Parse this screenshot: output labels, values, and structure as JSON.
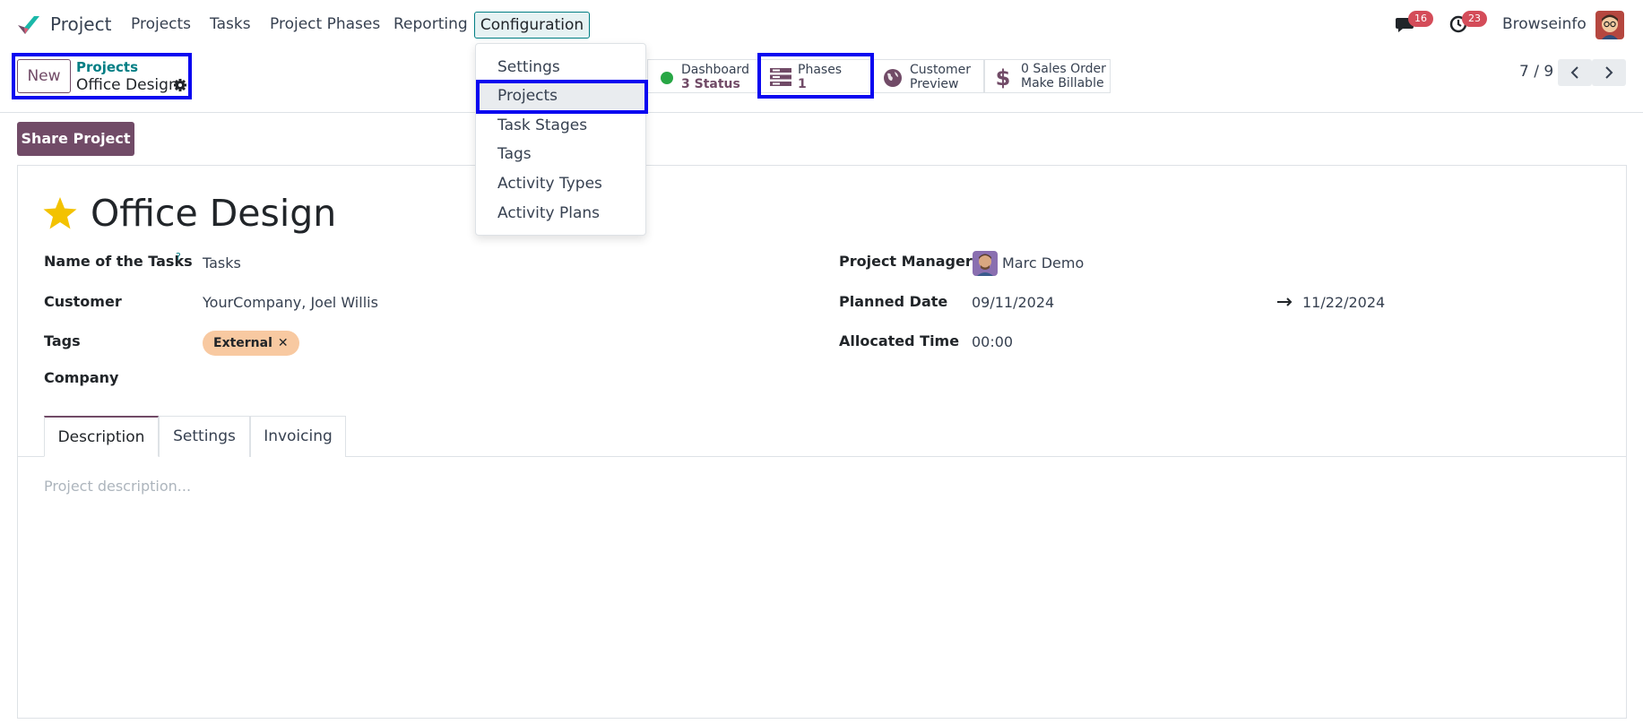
{
  "app": {
    "name": "Project"
  },
  "navbar": {
    "menus": [
      "Projects",
      "Tasks",
      "Project Phases",
      "Reporting",
      "Configuration"
    ],
    "messages_badge": "16",
    "activities_badge": "23",
    "company": "Browseinfo"
  },
  "control_panel": {
    "new_label": "New",
    "breadcrumb_parent": "Projects",
    "breadcrumb_current": "Office Design",
    "smart_buttons": {
      "dashboard": {
        "label": "Dashboard",
        "value": "3 Status"
      },
      "phases": {
        "label": "Phases",
        "value": "1"
      },
      "customer_preview": {
        "line1": "Customer",
        "line2": "Preview"
      },
      "sales_order": {
        "line1": "0 Sales Order",
        "line2": "Make Billable"
      }
    },
    "pager": "7 / 9"
  },
  "configuration_menu": {
    "items": [
      "Settings",
      "Projects",
      "Task Stages",
      "Tags",
      "Activity Types",
      "Activity Plans"
    ],
    "active": "Projects"
  },
  "share_label": "Share Project",
  "form": {
    "title": "Office Design",
    "fields": {
      "task_name_label": "Name of the Tasks",
      "task_name_help": "?",
      "task_name_value": "Tasks",
      "customer_label": "Customer",
      "customer_value": "YourCompany, Joel Willis",
      "tags_label": "Tags",
      "tag": "External",
      "tag_remove": "✕",
      "company_label": "Company",
      "manager_label": "Project Manager",
      "manager_value": "Marc Demo",
      "planned_label": "Planned Date",
      "planned_start": "09/11/2024",
      "planned_end": "11/22/2024",
      "allocated_label": "Allocated Time",
      "allocated_value": "00:00"
    },
    "tabs": [
      "Description",
      "Settings",
      "Invoicing"
    ],
    "description_placeholder": "Project description..."
  },
  "colors": {
    "accent": "#714b67",
    "teal": "#017e84",
    "highlight": "#0a06f0",
    "badge": "#d44c59",
    "tag": "#f8c9a1"
  }
}
